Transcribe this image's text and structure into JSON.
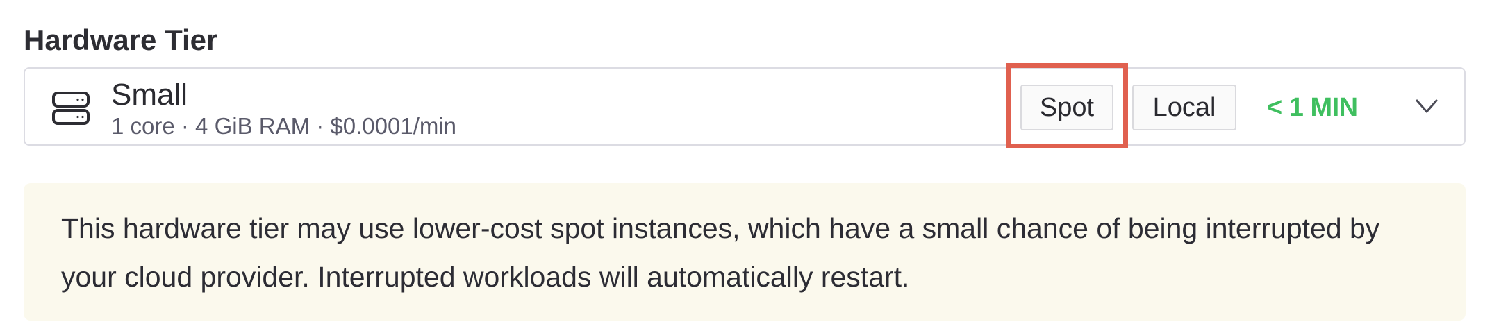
{
  "hardware_tier": {
    "label": "Hardware Tier",
    "selected": {
      "name": "Small",
      "specs": "1 core · 4 GiB RAM · $0.0001/min",
      "icon": "server-icon"
    },
    "badges": {
      "spot": "Spot",
      "local": "Local"
    },
    "eta": "< 1 MIN",
    "dropdown_icon": "chevron-down-icon"
  },
  "notice": {
    "text": "This hardware tier may use lower-cost spot instances, which have a small chance of being interrupted by your cloud provider. Interrupted workloads will automatically restart."
  },
  "colors": {
    "eta_green": "#3fbf5f",
    "highlight_red": "#e0604f",
    "notice_bg": "#fbf9ed",
    "border": "#dcdce3"
  }
}
